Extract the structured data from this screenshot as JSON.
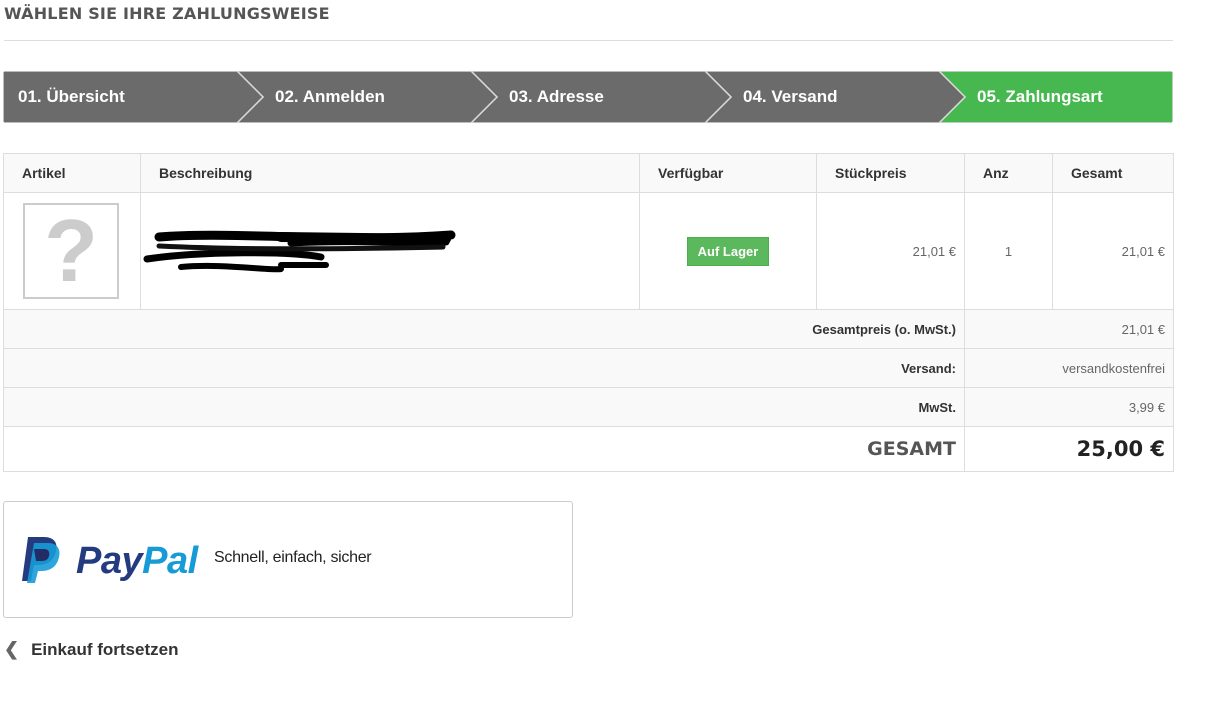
{
  "page": {
    "title": "WÄHLEN SIE IHRE ZAHLUNGSWEISE"
  },
  "steps": [
    {
      "label": "01. Übersicht",
      "active": false
    },
    {
      "label": "02. Anmelden",
      "active": false
    },
    {
      "label": "03. Adresse",
      "active": false
    },
    {
      "label": "04. Versand",
      "active": false
    },
    {
      "label": "05. Zahlungsart",
      "active": true
    }
  ],
  "colors": {
    "step_inactive": "#6b6b6b",
    "step_active": "#47b84f",
    "badge_green": "#5cb85c",
    "paypal_dark": "#253b80",
    "paypal_light": "#179bd7"
  },
  "cart": {
    "headers": {
      "article": "Artikel",
      "description": "Beschreibung",
      "available": "Verfügbar",
      "unit_price": "Stückpreis",
      "qty": "Anz",
      "total": "Gesamt"
    },
    "item": {
      "image_icon": "question-mark-placeholder",
      "availability": "Auf Lager",
      "unit_price": "21,01 €",
      "qty": "1",
      "total": "21,01 €"
    },
    "summary": {
      "subtotal_label": "Gesamtpreis (o. MwSt.)",
      "subtotal_value": "21,01 €",
      "shipping_label": "Versand:",
      "shipping_value": "versandkostenfrei",
      "tax_label": "MwSt.",
      "tax_value": "3,99 €",
      "grand_label": "GESAMT",
      "grand_value": "25,00 €"
    }
  },
  "payment": {
    "paypal_word_pay": "Pay",
    "paypal_word_pal": "Pal",
    "paypal_tagline": "Schnell, einfach, sicher"
  },
  "nav": {
    "continue_label": "Einkauf fortsetzen",
    "continue_icon": "chevron-left-icon"
  }
}
